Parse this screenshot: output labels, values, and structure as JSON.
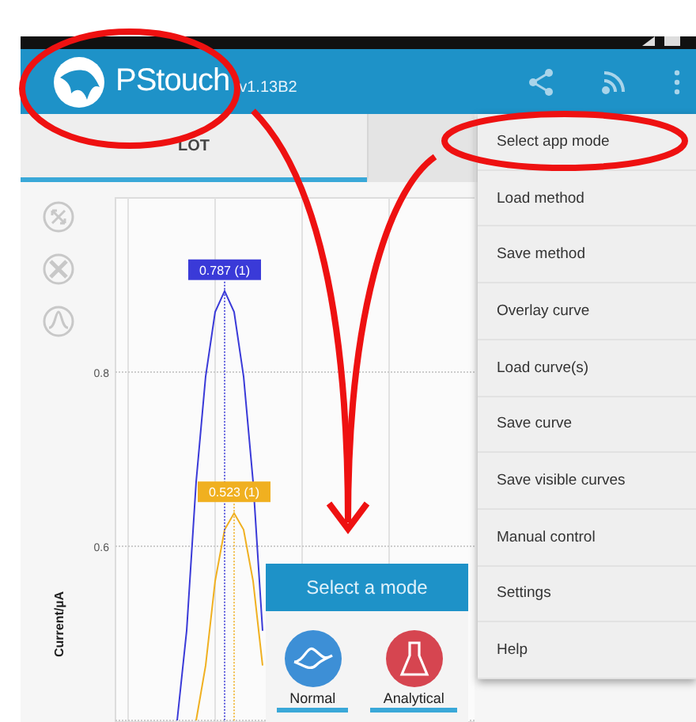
{
  "app_bar": {
    "title": "PStouch",
    "version": "v1.13B2"
  },
  "tabs": [
    {
      "label": "LOT",
      "selected": true
    },
    {
      "selected": false
    }
  ],
  "chart": {
    "chart_data": {
      "type": "line",
      "ylabel": "Current/µA",
      "ylim": [
        0.4,
        1.0
      ],
      "yticks": [
        0.6,
        0.8
      ],
      "categories": [
        null,
        null,
        null,
        null,
        null,
        null,
        null,
        null,
        null,
        null,
        null,
        null,
        null,
        null,
        null,
        null,
        null,
        null,
        null,
        null,
        null,
        null,
        null,
        null,
        null,
        null,
        null,
        null,
        null,
        null,
        null,
        null,
        null,
        null,
        null,
        null,
        null,
        null,
        null,
        null
      ],
      "series": [
        {
          "color": "#3a3ad8",
          "values": [
            null,
            null,
            null,
            null,
            null,
            null,
            0.4,
            0.503,
            0.674,
            0.795,
            0.869,
            0.893,
            0.869,
            0.795,
            0.674,
            0.503,
            null,
            null,
            null,
            null,
            null,
            null,
            null,
            null,
            null,
            null,
            null,
            null,
            null,
            null,
            null,
            null,
            null,
            null,
            null,
            null,
            null,
            null,
            null,
            null
          ]
        },
        {
          "color": "#f0b020",
          "values": [
            null,
            null,
            null,
            null,
            null,
            null,
            null,
            null,
            0.4,
            0.463,
            0.56,
            0.619,
            0.638,
            0.619,
            0.56,
            0.463,
            null,
            null,
            null,
            null,
            null,
            null,
            null,
            null,
            null,
            null,
            null,
            null,
            null,
            null,
            null,
            null,
            null,
            null,
            null,
            null,
            null,
            null,
            null,
            null
          ]
        }
      ],
      "grid": true,
      "annotations": [
        {
          "text": "0.787 (1)"
        },
        {
          "text": "0.523 (1)"
        }
      ]
    }
  },
  "mode_dialog": {
    "title": "Select a mode",
    "modes": [
      {
        "label": "Normal",
        "kind": "normal"
      },
      {
        "label": "Analytical",
        "kind": "analytical"
      }
    ]
  },
  "menu": {
    "items": [
      {
        "label": "Select app mode"
      },
      {
        "label": "Load method"
      },
      {
        "label": "Save method"
      },
      {
        "label": "Overlay curve"
      },
      {
        "label": "Load curve(s)"
      },
      {
        "label": "Save curve"
      },
      {
        "label": "Save visible curves"
      },
      {
        "label": "Manual control"
      },
      {
        "label": "Settings"
      },
      {
        "label": "Help"
      }
    ]
  }
}
